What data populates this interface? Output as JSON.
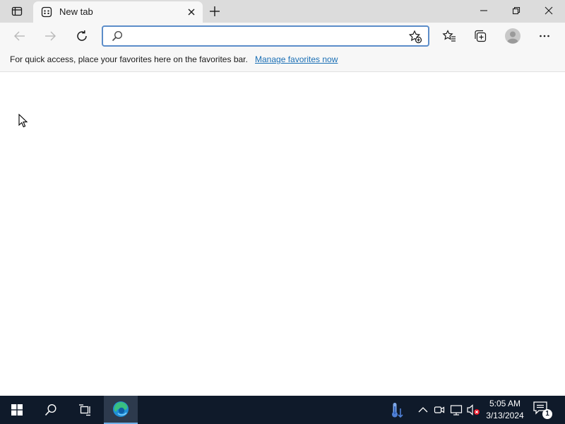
{
  "browser": {
    "tab": {
      "title": "New tab"
    },
    "address_bar": {
      "value": "",
      "placeholder": ""
    },
    "favorites_bar": {
      "message": "For quick access, place your favorites here on the favorites bar.",
      "link_label": "Manage favorites now"
    },
    "colors": {
      "accent": "#1a6fb5",
      "address_border": "#5c8dc9",
      "titlebar": "#dcdcdc",
      "toolbar": "#f7f7f7"
    },
    "icons": [
      "tab-actions-icon",
      "new-tab-page-icon",
      "close-icon",
      "plus-icon",
      "minimize-icon",
      "restore-icon",
      "window-close-icon",
      "back-arrow-icon",
      "forward-arrow-icon",
      "refresh-icon",
      "search-icon",
      "add-favorite-icon",
      "favorites-icon",
      "collections-icon",
      "profile-icon",
      "more-icon"
    ]
  },
  "taskbar": {
    "clock": {
      "time": "5:05 AM",
      "date": "3/13/2024"
    },
    "notification_count": "1",
    "icons": [
      "windows-start-icon",
      "search-icon",
      "task-view-icon",
      "edge-icon",
      "weather-icon",
      "chevron-up-icon",
      "meet-now-icon",
      "network-icon",
      "volume-muted-icon",
      "notification-icon"
    ],
    "colors": {
      "background": "#0f1a2a",
      "active_indicator": "#6fb0e8"
    }
  }
}
